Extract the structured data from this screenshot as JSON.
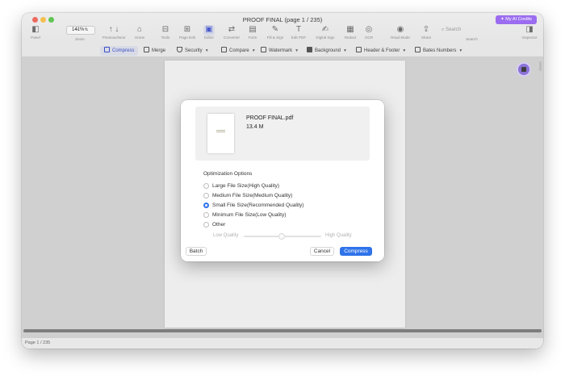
{
  "window": {
    "title": "PROOF FINAL (page 1 / 235)",
    "ai_credits_label": "My AI Credits"
  },
  "toolbar": {
    "panel_label": "Panel",
    "zoom_value": "141%",
    "zoom_label": "Zoom",
    "previous_next_label": "Previous/Next",
    "home_label": "Home",
    "tools_label": "Tools",
    "page_edit_label": "Page Edit",
    "editor_label": "Editor",
    "converter_label": "Converter",
    "form_label": "Form",
    "fill_sign_label": "Fill & Sign",
    "edit_pdf_label": "Edit PDF",
    "digital_sign_label": "Digital Sign",
    "redact_label": "Redact",
    "ocr_label": "OCR",
    "read_in_browser_label": "Read Mode",
    "share_label": "Share",
    "search_placeholder": "Search",
    "search_label": "Search",
    "inspector_label": "Inspector"
  },
  "subtoolbar": {
    "compress": "Compress",
    "merge": "Merge",
    "security": "Security",
    "compare": "Compare",
    "watermark": "Watermark",
    "background": "Background",
    "header_footer": "Header & Footer",
    "bates_numbers": "Bates Numbers"
  },
  "status": {
    "page_indicator": "Page 1 / 235"
  },
  "dialog": {
    "file_name": "PROOF FINAL.pdf",
    "file_size": "13.4 M",
    "section_title": "Optimization Options",
    "options": [
      {
        "label": "Large File Size(High Quality)",
        "selected": false
      },
      {
        "label": "Medium File Size(Medium Quality)",
        "selected": false
      },
      {
        "label": "Small File Size(Recommended Quality)",
        "selected": true
      },
      {
        "label": "Minimum File Size(Low Quality)",
        "selected": false
      },
      {
        "label": "Other",
        "selected": false
      }
    ],
    "quality_low_label": "Low Quality",
    "quality_high_label": "High Quality",
    "batch_button": "Batch",
    "cancel_button": "Cancel",
    "compress_button": "Compress"
  },
  "colors": {
    "accent": "#2f73ea",
    "ai_purple": "#9b6cf0"
  }
}
